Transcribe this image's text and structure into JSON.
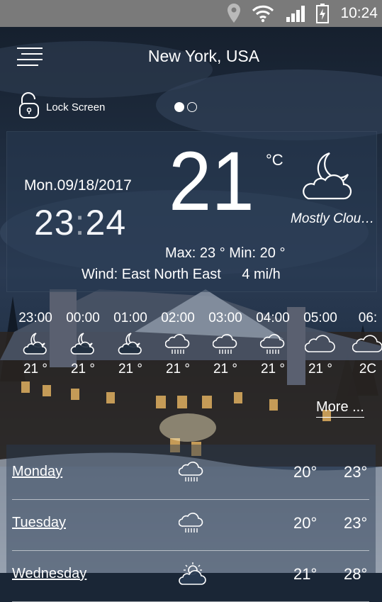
{
  "status_bar": {
    "time": "10:24",
    "icons": [
      "location-pin-icon",
      "wifi-icon",
      "signal-icon",
      "battery-charging-icon"
    ]
  },
  "header": {
    "menu_icon": "hamburger-menu-icon",
    "city": "New York, USA"
  },
  "lock_screen": {
    "icon": "unlock-padlock-icon",
    "label": "Lock Screen"
  },
  "page_indicator": {
    "count": 2,
    "active_index": 0
  },
  "current": {
    "date": "Mon.09/18/2017",
    "clock_hours": "23",
    "clock_separator": ":",
    "clock_minutes": "24",
    "temperature": "21",
    "unit": "°C",
    "condition_icon": "moon-cloud-icon",
    "condition": "Mostly Clou…",
    "max_label": "Max:",
    "max_value": "23 °",
    "min_label": "Min:",
    "min_value": "20 °",
    "wind_label": "Wind:",
    "wind_direction": "East North East",
    "wind_speed": "4 mi/h"
  },
  "hourly": [
    {
      "time": "23:00",
      "icon": "moon-cloud-icon",
      "temp": "21 °"
    },
    {
      "time": "00:00",
      "icon": "moon-cloud-icon",
      "temp": "21 °"
    },
    {
      "time": "01:00",
      "icon": "moon-cloud-icon",
      "temp": "21 °"
    },
    {
      "time": "02:00",
      "icon": "rain-cloud-icon",
      "temp": "21 °"
    },
    {
      "time": "03:00",
      "icon": "rain-cloud-icon",
      "temp": "21 °"
    },
    {
      "time": "04:00",
      "icon": "rain-cloud-icon",
      "temp": "21 °"
    },
    {
      "time": "05:00",
      "icon": "cloud-icon",
      "temp": "21 °"
    },
    {
      "time": "06:",
      "icon": "cloud-icon",
      "temp": "2C"
    }
  ],
  "more_label": "More ...",
  "daily": [
    {
      "day": "Monday",
      "icon": "rain-cloud-icon",
      "low": "20°",
      "high": "23°"
    },
    {
      "day": "Tuesday",
      "icon": "rain-cloud-icon",
      "low": "20°",
      "high": "23°"
    },
    {
      "day": "Wednesday",
      "icon": "sun-cloud-icon",
      "low": "21°",
      "high": "28°"
    }
  ],
  "colors": {
    "status_bar": "#7a7a7a",
    "text": "#ffffff",
    "panel": "#283a52"
  }
}
